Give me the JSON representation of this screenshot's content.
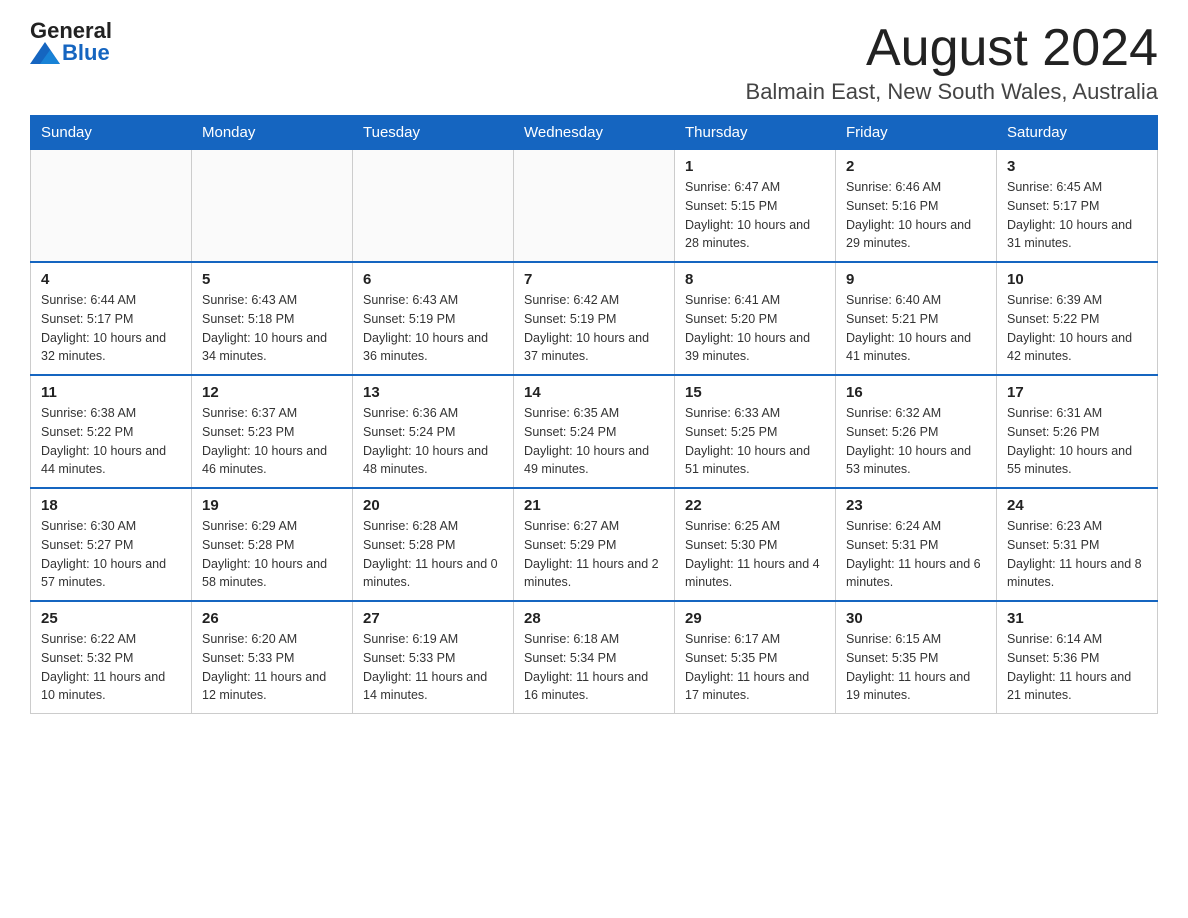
{
  "header": {
    "logo_general": "General",
    "logo_blue": "Blue",
    "month_title": "August 2024",
    "location": "Balmain East, New South Wales, Australia"
  },
  "columns": [
    "Sunday",
    "Monday",
    "Tuesday",
    "Wednesday",
    "Thursday",
    "Friday",
    "Saturday"
  ],
  "weeks": [
    [
      {
        "day": "",
        "info": ""
      },
      {
        "day": "",
        "info": ""
      },
      {
        "day": "",
        "info": ""
      },
      {
        "day": "",
        "info": ""
      },
      {
        "day": "1",
        "info": "Sunrise: 6:47 AM\nSunset: 5:15 PM\nDaylight: 10 hours and 28 minutes."
      },
      {
        "day": "2",
        "info": "Sunrise: 6:46 AM\nSunset: 5:16 PM\nDaylight: 10 hours and 29 minutes."
      },
      {
        "day": "3",
        "info": "Sunrise: 6:45 AM\nSunset: 5:17 PM\nDaylight: 10 hours and 31 minutes."
      }
    ],
    [
      {
        "day": "4",
        "info": "Sunrise: 6:44 AM\nSunset: 5:17 PM\nDaylight: 10 hours and 32 minutes."
      },
      {
        "day": "5",
        "info": "Sunrise: 6:43 AM\nSunset: 5:18 PM\nDaylight: 10 hours and 34 minutes."
      },
      {
        "day": "6",
        "info": "Sunrise: 6:43 AM\nSunset: 5:19 PM\nDaylight: 10 hours and 36 minutes."
      },
      {
        "day": "7",
        "info": "Sunrise: 6:42 AM\nSunset: 5:19 PM\nDaylight: 10 hours and 37 minutes."
      },
      {
        "day": "8",
        "info": "Sunrise: 6:41 AM\nSunset: 5:20 PM\nDaylight: 10 hours and 39 minutes."
      },
      {
        "day": "9",
        "info": "Sunrise: 6:40 AM\nSunset: 5:21 PM\nDaylight: 10 hours and 41 minutes."
      },
      {
        "day": "10",
        "info": "Sunrise: 6:39 AM\nSunset: 5:22 PM\nDaylight: 10 hours and 42 minutes."
      }
    ],
    [
      {
        "day": "11",
        "info": "Sunrise: 6:38 AM\nSunset: 5:22 PM\nDaylight: 10 hours and 44 minutes."
      },
      {
        "day": "12",
        "info": "Sunrise: 6:37 AM\nSunset: 5:23 PM\nDaylight: 10 hours and 46 minutes."
      },
      {
        "day": "13",
        "info": "Sunrise: 6:36 AM\nSunset: 5:24 PM\nDaylight: 10 hours and 48 minutes."
      },
      {
        "day": "14",
        "info": "Sunrise: 6:35 AM\nSunset: 5:24 PM\nDaylight: 10 hours and 49 minutes."
      },
      {
        "day": "15",
        "info": "Sunrise: 6:33 AM\nSunset: 5:25 PM\nDaylight: 10 hours and 51 minutes."
      },
      {
        "day": "16",
        "info": "Sunrise: 6:32 AM\nSunset: 5:26 PM\nDaylight: 10 hours and 53 minutes."
      },
      {
        "day": "17",
        "info": "Sunrise: 6:31 AM\nSunset: 5:26 PM\nDaylight: 10 hours and 55 minutes."
      }
    ],
    [
      {
        "day": "18",
        "info": "Sunrise: 6:30 AM\nSunset: 5:27 PM\nDaylight: 10 hours and 57 minutes."
      },
      {
        "day": "19",
        "info": "Sunrise: 6:29 AM\nSunset: 5:28 PM\nDaylight: 10 hours and 58 minutes."
      },
      {
        "day": "20",
        "info": "Sunrise: 6:28 AM\nSunset: 5:28 PM\nDaylight: 11 hours and 0 minutes."
      },
      {
        "day": "21",
        "info": "Sunrise: 6:27 AM\nSunset: 5:29 PM\nDaylight: 11 hours and 2 minutes."
      },
      {
        "day": "22",
        "info": "Sunrise: 6:25 AM\nSunset: 5:30 PM\nDaylight: 11 hours and 4 minutes."
      },
      {
        "day": "23",
        "info": "Sunrise: 6:24 AM\nSunset: 5:31 PM\nDaylight: 11 hours and 6 minutes."
      },
      {
        "day": "24",
        "info": "Sunrise: 6:23 AM\nSunset: 5:31 PM\nDaylight: 11 hours and 8 minutes."
      }
    ],
    [
      {
        "day": "25",
        "info": "Sunrise: 6:22 AM\nSunset: 5:32 PM\nDaylight: 11 hours and 10 minutes."
      },
      {
        "day": "26",
        "info": "Sunrise: 6:20 AM\nSunset: 5:33 PM\nDaylight: 11 hours and 12 minutes."
      },
      {
        "day": "27",
        "info": "Sunrise: 6:19 AM\nSunset: 5:33 PM\nDaylight: 11 hours and 14 minutes."
      },
      {
        "day": "28",
        "info": "Sunrise: 6:18 AM\nSunset: 5:34 PM\nDaylight: 11 hours and 16 minutes."
      },
      {
        "day": "29",
        "info": "Sunrise: 6:17 AM\nSunset: 5:35 PM\nDaylight: 11 hours and 17 minutes."
      },
      {
        "day": "30",
        "info": "Sunrise: 6:15 AM\nSunset: 5:35 PM\nDaylight: 11 hours and 19 minutes."
      },
      {
        "day": "31",
        "info": "Sunrise: 6:14 AM\nSunset: 5:36 PM\nDaylight: 11 hours and 21 minutes."
      }
    ]
  ]
}
